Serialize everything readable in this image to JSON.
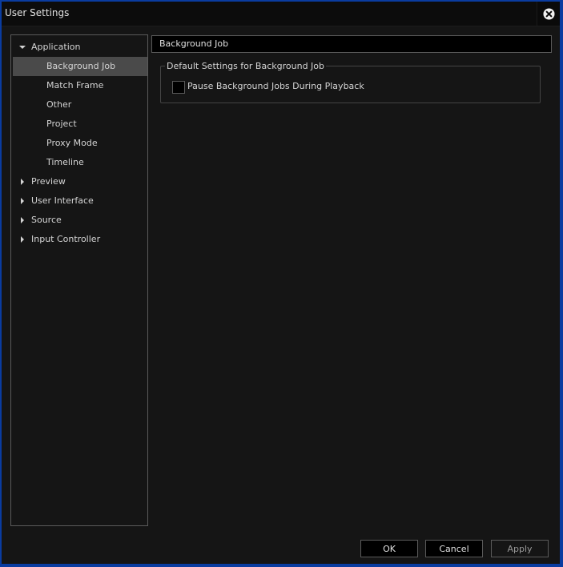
{
  "window": {
    "title": "User Settings",
    "close_icon": "close-circle-icon"
  },
  "sidebar": {
    "items": [
      {
        "label": "Application",
        "level": 0,
        "expanded": true,
        "selected": false
      },
      {
        "label": "Background Job",
        "level": 1,
        "selected": true
      },
      {
        "label": "Match Frame",
        "level": 1,
        "selected": false
      },
      {
        "label": "Other",
        "level": 1,
        "selected": false
      },
      {
        "label": "Project",
        "level": 1,
        "selected": false
      },
      {
        "label": "Proxy Mode",
        "level": 1,
        "selected": false
      },
      {
        "label": "Timeline",
        "level": 1,
        "selected": false
      },
      {
        "label": "Preview",
        "level": 0,
        "expanded": false,
        "selected": false
      },
      {
        "label": "User Interface",
        "level": 0,
        "expanded": false,
        "selected": false
      },
      {
        "label": "Source",
        "level": 0,
        "expanded": false,
        "selected": false
      },
      {
        "label": "Input Controller",
        "level": 0,
        "expanded": false,
        "selected": false
      }
    ]
  },
  "main": {
    "section_title": "Background Job",
    "group": {
      "legend": "Default Settings for Background Job",
      "options": [
        {
          "label": "Pause Background Jobs During Playback",
          "checked": false
        }
      ]
    }
  },
  "footer": {
    "ok_label": "OK",
    "cancel_label": "Cancel",
    "apply_label": "Apply",
    "apply_enabled": false
  }
}
